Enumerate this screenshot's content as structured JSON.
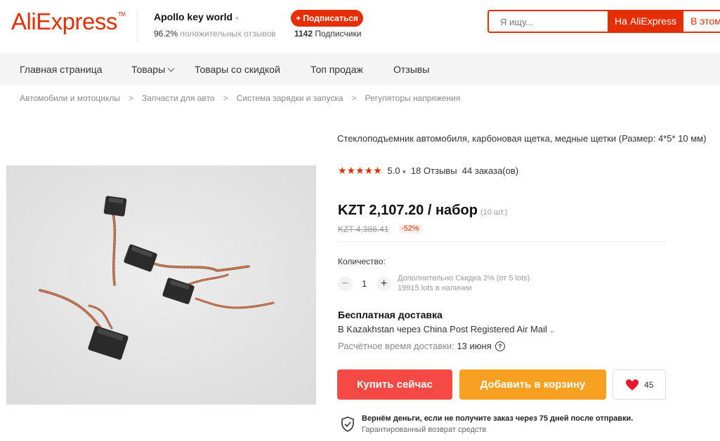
{
  "header": {
    "logo_text": "AliExpress",
    "logo_tm": "TM",
    "store_name": "Apollo key world",
    "store_caret": "▾",
    "store_positive_pct": "96.2%",
    "store_positive_label": "положительных отзывов",
    "follow_label": "+ Подписаться",
    "followers_count": "1142",
    "followers_label": "Подписчики",
    "search_placeholder": "Я ищу...",
    "search_ali_label": "На AliExpress",
    "search_store_label": "В этом"
  },
  "nav": {
    "items": [
      "Главная страница",
      "Товары",
      "Товары со скидкой",
      "Топ продаж",
      "Отзывы"
    ]
  },
  "breadcrumbs": [
    "Автомобили и мотоциклы",
    "Запчасти для авто",
    "Система зарядки и запуска",
    "Регуляторы напряжения"
  ],
  "breadcrumb_sep": ">",
  "product": {
    "title": "Стеклоподъемник автомобиля, карбоновая щетка, медные щетки (Размер: 4*5* 10 мм)",
    "stars": "★★★★★",
    "rating": "5.0",
    "rating_caret": "▾",
    "reviews": "18 Отзывы",
    "orders": "44 заказа(ов)",
    "price": "KZT 2,107.20 / набор",
    "price_unit": "(10 шт.)",
    "old_price": "KZT 4,386.41",
    "discount": "-52%",
    "quantity_label": "Количество:",
    "qty_minus": "−",
    "quantity_value": "1",
    "qty_plus": "+",
    "qty_discount_info": "Дополнительно Скидка 2% (от 5 lots)",
    "qty_stock_info": "19915 lots в наличии",
    "shipping_title": "Бесплатная доставка",
    "shipping_method": "В Kazakhstan через China Post Registered Air Mail",
    "shipping_caret": "⌄",
    "eta_label": "Расчётное время доставки:",
    "eta_date": "13 июня",
    "eta_help": "?",
    "buy_now_label": "Купить сейчас",
    "add_to_cart_label": "Добавить в корзину",
    "wishlist_count": "45",
    "guarantee_title": "Вернём деньги, если не получите заказ через 75 дней после отправки.",
    "guarantee_sub": "Гарантированный возврат средств"
  },
  "colors": {
    "brand": "#e62e04",
    "buy_now": "#f44a45",
    "add_to_cart": "#f8a022",
    "heart": "#e5192c"
  }
}
